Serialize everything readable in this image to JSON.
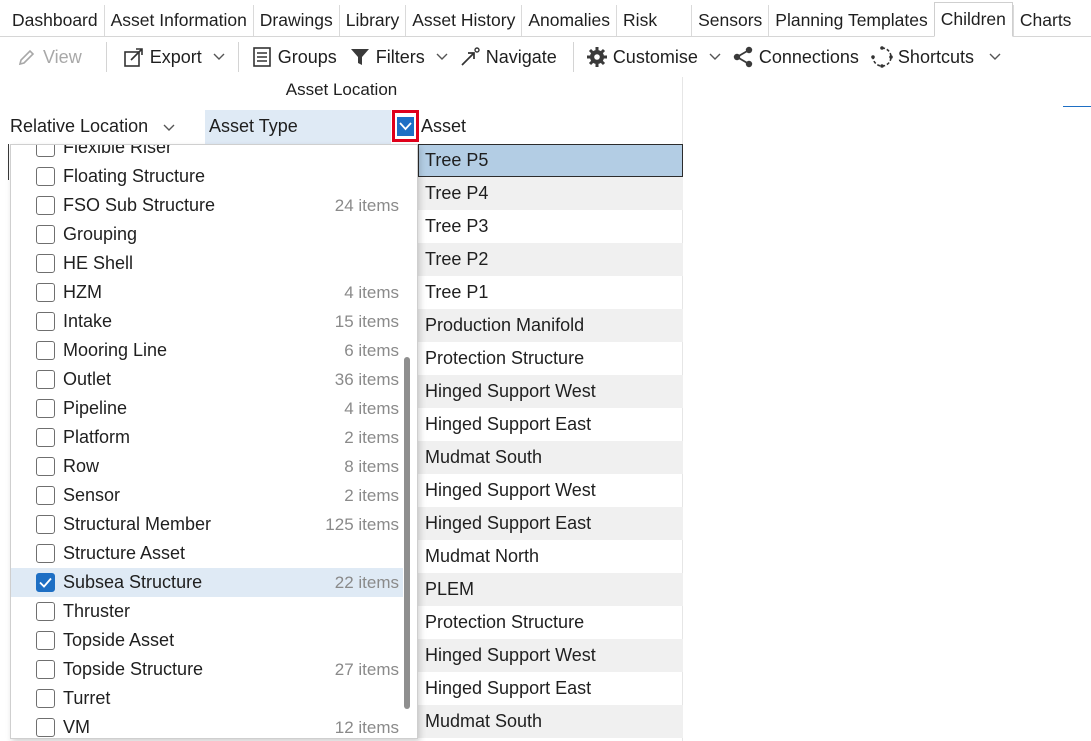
{
  "tabs": [
    {
      "label": "Dashboard",
      "active": false
    },
    {
      "label": "Asset Information",
      "active": false
    },
    {
      "label": "Drawings",
      "active": false
    },
    {
      "label": "Library",
      "active": false
    },
    {
      "label": "Asset History",
      "active": false
    },
    {
      "label": "Anomalies",
      "active": false
    },
    {
      "label": "Risk",
      "active": false
    },
    {
      "label": "Sensors",
      "active": false
    },
    {
      "label": "Planning Templates",
      "active": false
    },
    {
      "label": "Children",
      "active": true
    },
    {
      "label": "Charts",
      "active": false
    }
  ],
  "toolbar": {
    "view": "View",
    "export": "Export",
    "groups": "Groups",
    "filters": "Filters",
    "navigate": "Navigate",
    "customise": "Customise",
    "connections": "Connections",
    "shortcuts": "Shortcuts"
  },
  "grid": {
    "group_header": "Asset Location",
    "columns": {
      "relative_location": "Relative Location",
      "asset_type": "Asset Type",
      "asset": "Asset"
    }
  },
  "assets": [
    "Tree P5",
    "Tree P4",
    "Tree P3",
    "Tree P2",
    "Tree P1",
    "Production Manifold",
    "Protection Structure",
    "Hinged Support West",
    "Hinged Support East",
    "Mudmat South",
    "Hinged Support West",
    "Hinged Support East",
    "Mudmat North",
    "PLEM",
    "Protection Structure",
    "Hinged Support West",
    "Hinged Support East",
    "Mudmat South"
  ],
  "filter_popup": {
    "items": [
      {
        "label": "Flexible Riser",
        "count": "",
        "checked": false
      },
      {
        "label": "Floating Structure",
        "count": "",
        "checked": false
      },
      {
        "label": "FSO Sub Structure",
        "count": "24 items",
        "checked": false
      },
      {
        "label": "Grouping",
        "count": "",
        "checked": false
      },
      {
        "label": "HE Shell",
        "count": "",
        "checked": false
      },
      {
        "label": "HZM",
        "count": "4 items",
        "checked": false
      },
      {
        "label": "Intake",
        "count": "15 items",
        "checked": false
      },
      {
        "label": "Mooring Line",
        "count": "6 items",
        "checked": false
      },
      {
        "label": "Outlet",
        "count": "36 items",
        "checked": false
      },
      {
        "label": "Pipeline",
        "count": "4 items",
        "checked": false
      },
      {
        "label": "Platform",
        "count": "2 items",
        "checked": false
      },
      {
        "label": "Row",
        "count": "8 items",
        "checked": false
      },
      {
        "label": "Sensor",
        "count": "2 items",
        "checked": false
      },
      {
        "label": "Structural Member",
        "count": "125 items",
        "checked": false
      },
      {
        "label": "Structure Asset",
        "count": "",
        "checked": false
      },
      {
        "label": "Subsea Structure",
        "count": "22 items",
        "checked": true
      },
      {
        "label": "Thruster",
        "count": "",
        "checked": false
      },
      {
        "label": "Topside Asset",
        "count": "",
        "checked": false
      },
      {
        "label": "Topside Structure",
        "count": "27 items",
        "checked": false
      },
      {
        "label": "Turret",
        "count": "",
        "checked": false
      },
      {
        "label": "VM",
        "count": "12 items",
        "checked": false
      }
    ]
  },
  "colors": {
    "accent": "#1e6fc4",
    "selected_row": "#b3cde4",
    "highlight": "#e0001b",
    "header_highlight": "#dfeaf5"
  }
}
